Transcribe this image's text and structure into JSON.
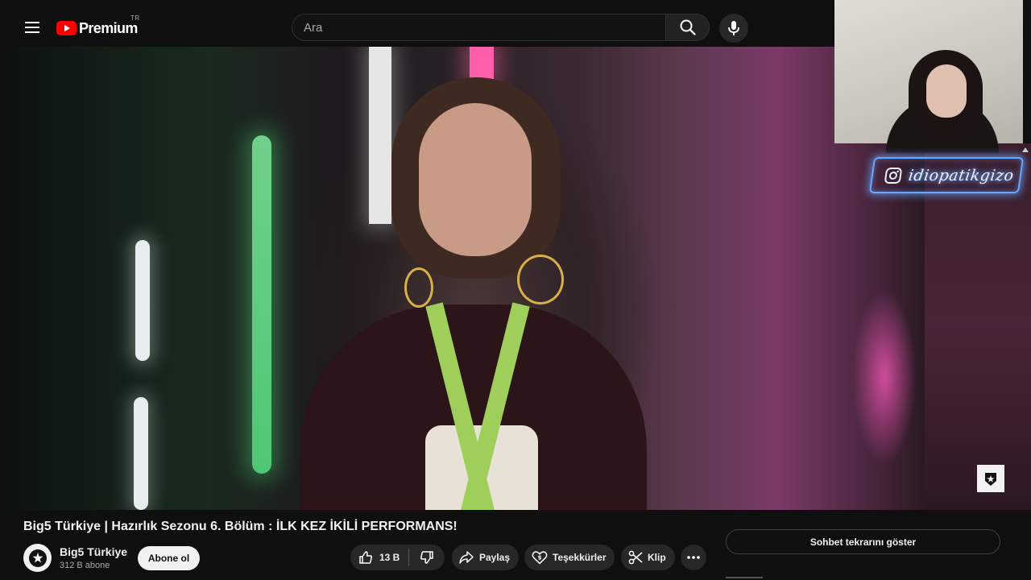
{
  "header": {
    "logo_text": "Premium",
    "logo_country": "TR",
    "search_placeholder": "Ara"
  },
  "overlay": {
    "neon_sign_text": "idiopatikgizo"
  },
  "video": {
    "title": "Big5 Türkiye | Hazırlık Sezonu 6. Bölüm : İLK KEZ İKİLİ PERFORMANS!",
    "channel": {
      "name": "Big5 Türkiye",
      "subscribers": "312 B abone",
      "subscribe_label": "Abone ol"
    },
    "actions": {
      "like_count": "13 B",
      "share_label": "Paylaş",
      "thanks_label": "Teşekkürler",
      "clip_label": "Klip"
    }
  },
  "sidebar": {
    "chat_replay_label": "Sohbet tekrarını göster"
  },
  "colors": {
    "background": "#0f0f0f",
    "youtube_red": "#ff0000",
    "pill": "#272727",
    "neon_blue": "#6aa8ff"
  }
}
